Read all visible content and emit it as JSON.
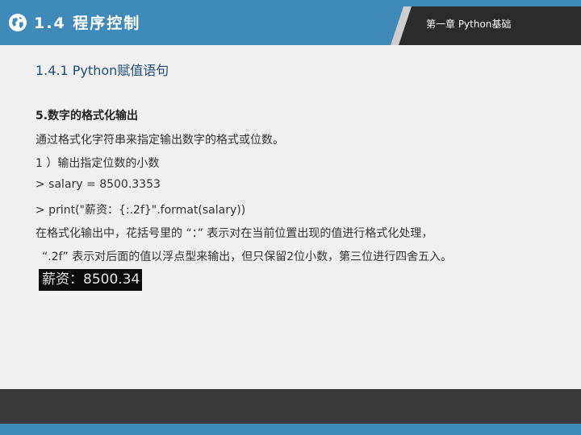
{
  "header": {
    "section_title": "1.4  程序控制",
    "chapter_label": "第一章 Python基础",
    "logo_icon": "globe-icon",
    "colors": {
      "header_blue": "#3f8ab8",
      "tab_dark": "#2b2b2b"
    }
  },
  "content": {
    "subtitle": "1.4.1  Python赋值语句",
    "heading": "5.数字的格式化输出",
    "lines": [
      "通过格式化字符串来指定输出数字的格式或位数。",
      "1 ）输出指定位数的小数",
      "> salary = 8500.3353",
      "> print(\"薪资：{:.2f}\".format(salary))",
      "在格式化输出中，花括号里的 “：” 表示对在当前位置出现的值进行格式化处理，",
      "“.2f” 表示对后面的值以浮点型来输出，但只保留2位小数，第三位进行四舍五入。"
    ],
    "output": "薪资：8500.34"
  },
  "footer": {
    "colors": {
      "dark": "#3a3a3a",
      "blue": "#3f8ab8"
    }
  }
}
